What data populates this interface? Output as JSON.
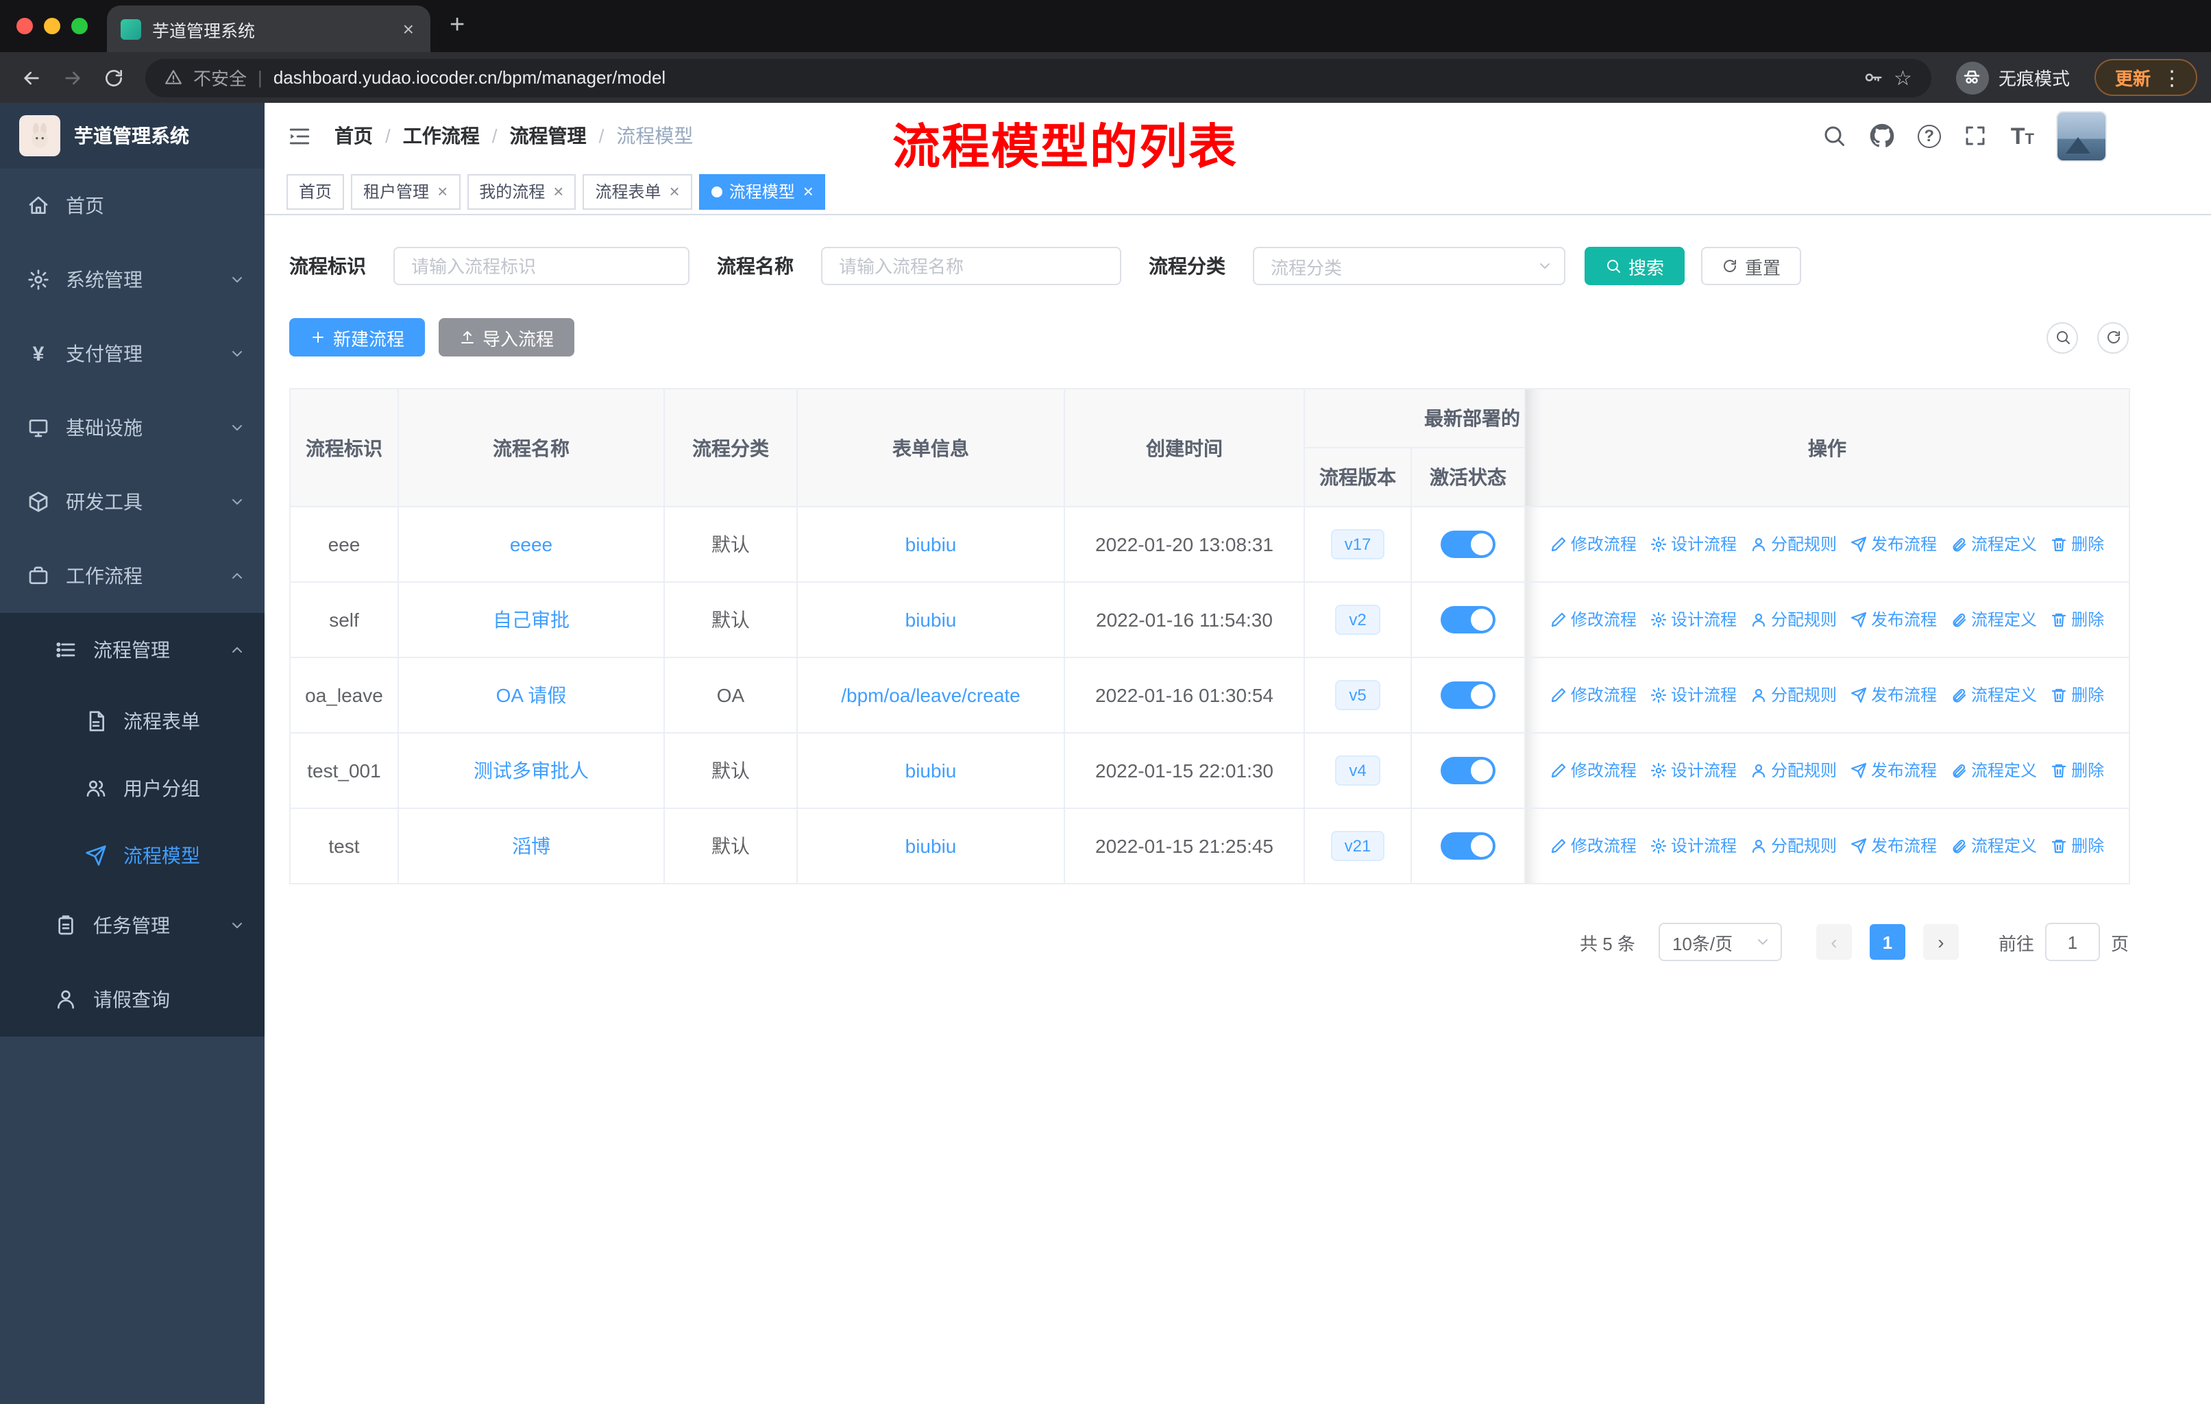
{
  "colors": {
    "primary": "#409eff",
    "search_button": "#14b8a6",
    "sidebar_bg": "#304156",
    "submenu_bg": "#1f2d3d",
    "annotation_red": "#ff0000",
    "toggle_on": "#409eff"
  },
  "browser": {
    "tab_title": "芋道管理系统",
    "security_label": "不安全",
    "url": "dashboard.yudao.iocoder.cn/bpm/manager/model",
    "incognito_label": "无痕模式",
    "update_label": "更新"
  },
  "sidebar": {
    "logo_title": "芋道管理系统",
    "items": [
      "首页",
      "系统管理",
      "支付管理",
      "基础设施",
      "研发工具",
      "工作流程"
    ],
    "sub_items": [
      "流程管理",
      "流程表单",
      "用户分组",
      "流程模型",
      "任务管理",
      "请假查询"
    ]
  },
  "header": {
    "breadcrumb": [
      "首页",
      "工作流程",
      "流程管理",
      "流程模型"
    ],
    "annotation": "流程模型的列表"
  },
  "tags": [
    {
      "label": "首页"
    },
    {
      "label": "租户管理"
    },
    {
      "label": "我的流程"
    },
    {
      "label": "流程表单"
    },
    {
      "label": "流程模型"
    }
  ],
  "filters": {
    "key_label": "流程标识",
    "key_placeholder": "请输入流程标识",
    "name_label": "流程名称",
    "name_placeholder": "请输入流程名称",
    "category_label": "流程分类",
    "category_placeholder": "流程分类",
    "search_label": "搜索",
    "reset_label": "重置"
  },
  "toolbar": {
    "create_label": "新建流程",
    "import_label": "导入流程"
  },
  "table": {
    "headers": {
      "key": "流程标识",
      "name": "流程名称",
      "category": "流程分类",
      "form": "表单信息",
      "create_time": "创建时间",
      "deploy_group": "最新部署的",
      "version": "流程版本",
      "active_state": "激活状态",
      "actions": "操作"
    },
    "row_actions": [
      "修改流程",
      "设计流程",
      "分配规则",
      "发布流程",
      "流程定义",
      "删除"
    ],
    "rows": [
      {
        "key": "eee",
        "name": "eeee",
        "category": "默认",
        "form": "biubiu",
        "create_time": "2022-01-20 13:08:31",
        "version": "v17",
        "active": true
      },
      {
        "key": "self",
        "name": "自己审批",
        "category": "默认",
        "form": "biubiu",
        "create_time": "2022-01-16 11:54:30",
        "version": "v2",
        "active": true
      },
      {
        "key": "oa_leave",
        "name": "OA 请假",
        "category": "OA",
        "form": "/bpm/oa/leave/create",
        "create_time": "2022-01-16 01:30:54",
        "version": "v5",
        "active": true
      },
      {
        "key": "test_001",
        "name": "测试多审批人",
        "category": "默认",
        "form": "biubiu",
        "create_time": "2022-01-15 22:01:30",
        "version": "v4",
        "active": true
      },
      {
        "key": "test",
        "name": "滔博",
        "category": "默认",
        "form": "biubiu",
        "create_time": "2022-01-15 21:25:45",
        "version": "v21",
        "active": true
      }
    ]
  },
  "pagination": {
    "total_label": "共 5 条",
    "page_size": "10条/页",
    "current_page": "1",
    "goto_label": "前往",
    "goto_value": "1",
    "page_label": "页"
  }
}
